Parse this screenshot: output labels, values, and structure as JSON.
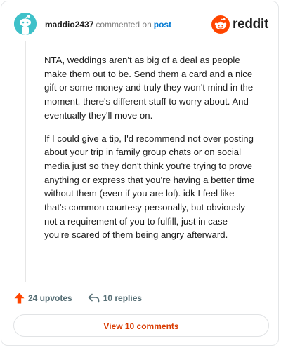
{
  "comment": {
    "username": "maddio2437",
    "action_text": "commented on",
    "post_link": "post",
    "paragraphs": [
      "NTA, weddings aren't as big of a deal as people make them out to be. Send them a card and a nice gift or some money and truly they won't mind in the moment, there's different stuff to worry about. And eventually they'll move on.",
      "If I could give a tip, I'd recommend not over posting about your trip in family group chats or on social media just so they don't think you're trying to prove anything or express that you're having a better time without them (even if you are lol). idk I feel like that's common courtesy personally, but obviously not a requirement of you to fulfill, just in case you're scared of them being angry afterward."
    ]
  },
  "brand": {
    "wordmark": "reddit",
    "color": "#ff4500"
  },
  "actions": {
    "upvotes": "24 upvotes",
    "replies": "10 replies",
    "upvote_icon": "upvote-arrow-icon",
    "reply_icon": "reply-arrow-icon"
  },
  "view_comments": "View 10 comments",
  "colors": {
    "accent": "#d93a00",
    "link": "#0079d3",
    "upvote": "#ff4500",
    "avatar_bg": "#3fc1c9"
  }
}
